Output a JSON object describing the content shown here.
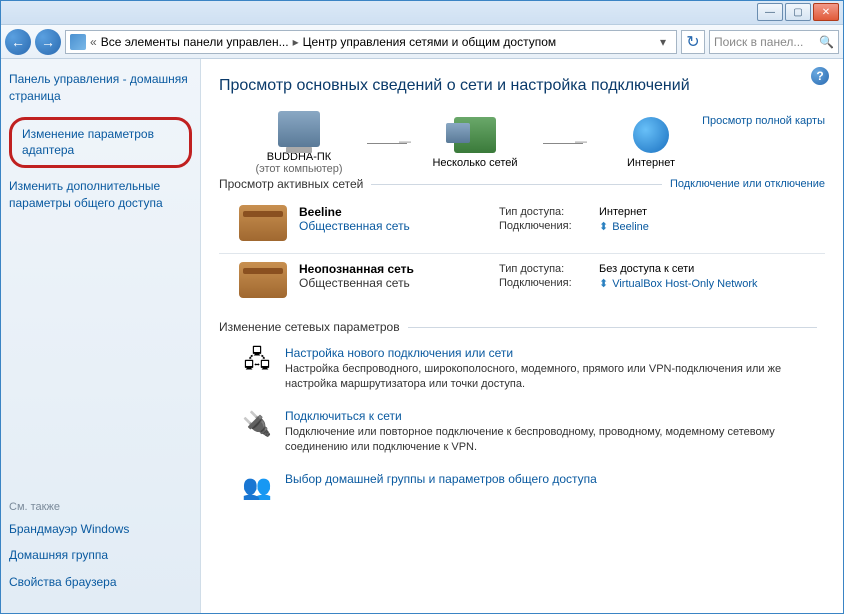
{
  "titlebar": {
    "min": "—",
    "max": "▢",
    "close": "✕"
  },
  "nav": {
    "addr_prefix": "«",
    "addr1": "Все элементы панели управлен...",
    "addr2": "Центр управления сетями и общим доступом",
    "refresh": "↻",
    "search_placeholder": "Поиск в панел..."
  },
  "sidebar": {
    "home": "Панель управления - домашняя страница",
    "adapter": "Изменение параметров адаптера",
    "sharing": "Изменить дополнительные параметры общего доступа",
    "seealso": "См. также",
    "firewall": "Брандмауэр Windows",
    "homegroup": "Домашняя группа",
    "browser": "Свойства браузера"
  },
  "content": {
    "title": "Просмотр основных сведений о сети и настройка подключений",
    "node_pc": "BUDDHA-ПК",
    "node_pc_sub": "(этот компьютер)",
    "node_multi": "Несколько сетей",
    "node_internet": "Интернет",
    "fullmap": "Просмотр полной карты",
    "active_label": "Просмотр активных сетей",
    "connect_action": "Подключение или отключение",
    "net1": {
      "name": "Beeline",
      "cat": "Общественная сеть",
      "access_lbl": "Тип доступа:",
      "access_val": "Интернет",
      "conn_lbl": "Подключения:",
      "conn_val": "Beeline"
    },
    "net2": {
      "name": "Неопознанная сеть",
      "cat": "Общественная сеть",
      "access_lbl": "Тип доступа:",
      "access_val": "Без доступа к сети",
      "conn_lbl": "Подключения:",
      "conn_val": "VirtualBox Host-Only Network"
    },
    "change_label": "Изменение сетевых параметров",
    "s1_title": "Настройка нового подключения или сети",
    "s1_desc": "Настройка беспроводного, широкополосного, модемного, прямого или VPN-подключения или же настройка маршрутизатора или точки доступа.",
    "s2_title": "Подключиться к сети",
    "s2_desc": "Подключение или повторное подключение к беспроводному, проводному, модемному сетевому соединению или подключение к VPN.",
    "s3_title": "Выбор домашней группы и параметров общего доступа"
  }
}
